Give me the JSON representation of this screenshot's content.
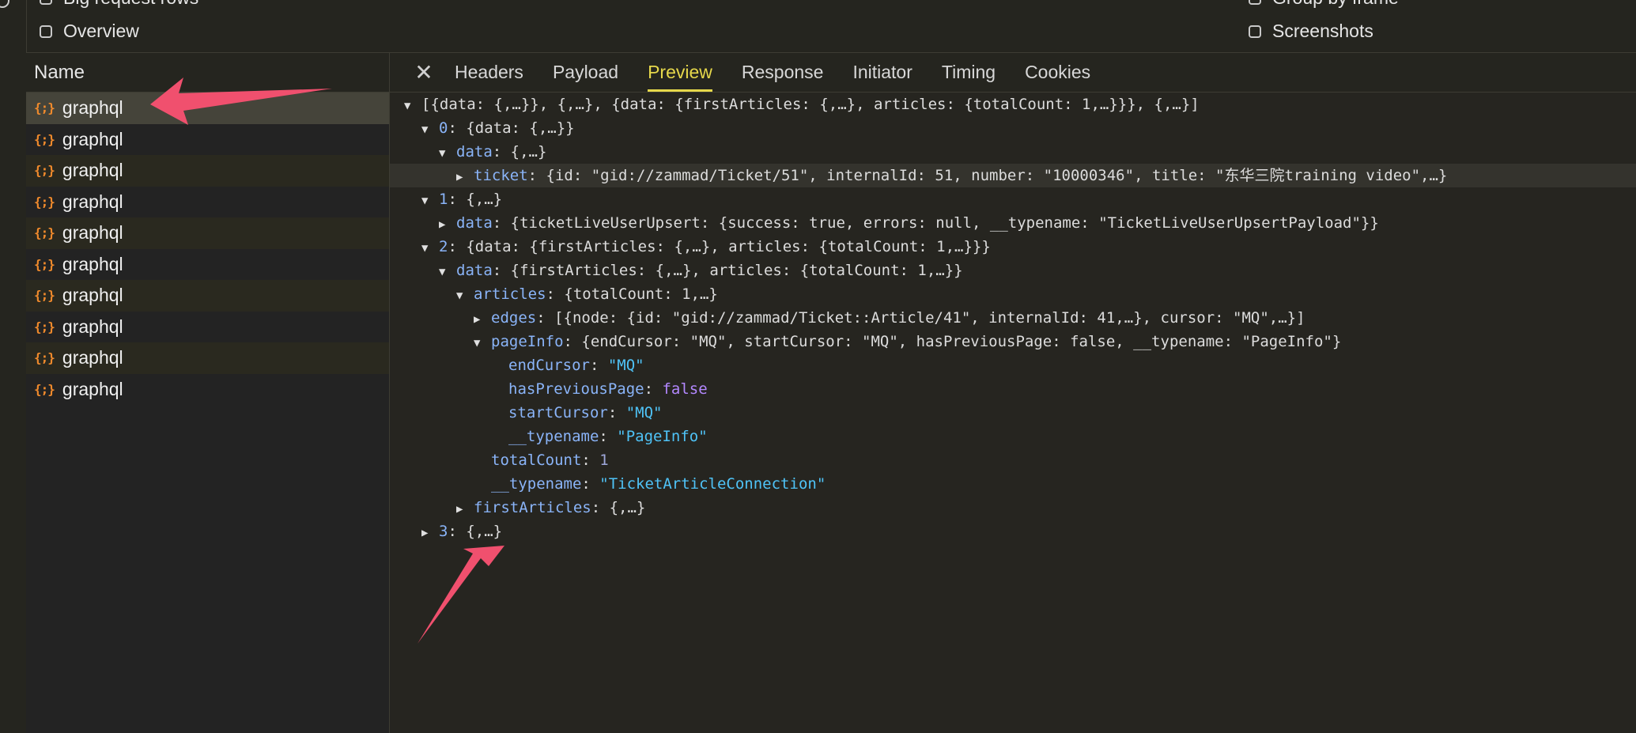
{
  "toolbar": {
    "options": [
      {
        "label": "Big request rows",
        "checked": false
      },
      {
        "label": "Overview",
        "checked": false
      },
      {
        "label": "Group by frame",
        "checked": false
      },
      {
        "label": "Screenshots",
        "checked": false
      }
    ]
  },
  "name_panel": {
    "header": "Name",
    "icon": "json-braces-icon",
    "icon_glyph": "{;}",
    "requests": [
      "graphql",
      "graphql",
      "graphql",
      "graphql",
      "graphql",
      "graphql",
      "graphql",
      "graphql",
      "graphql",
      "graphql"
    ]
  },
  "detail": {
    "tabs": [
      "Headers",
      "Payload",
      "Preview",
      "Response",
      "Initiator",
      "Timing",
      "Cookies"
    ],
    "active_tab": "Preview",
    "tree": [
      {
        "arrow": "▼",
        "text": "[{data: {,…}}, {,…}, {data: {firstArticles: {,…}, articles: {totalCount: 1,…}}}, {,…}]"
      },
      {
        "arrow": "▼",
        "key": "0",
        "text": "{data: {,…}}"
      },
      {
        "arrow": "▼",
        "key": "data",
        "text": "{,…}"
      },
      {
        "arrow": "▶",
        "key": "ticket",
        "text": "{id: \"gid://zammad/Ticket/51\", internalId: 51, number: \"10000346\", title: \"东华三院training video\",…}"
      },
      {
        "arrow": "▼",
        "key": "1",
        "text": "{,…}"
      },
      {
        "arrow": "▶",
        "key": "data",
        "text": "{ticketLiveUserUpsert: {success: true, errors: null, __typename: \"TicketLiveUserUpsertPayload\"}}"
      },
      {
        "arrow": "▼",
        "key": "2",
        "text": "{data: {firstArticles: {,…}, articles: {totalCount: 1,…}}}"
      },
      {
        "arrow": "▼",
        "key": "data",
        "text": "{firstArticles: {,…}, articles: {totalCount: 1,…}}"
      },
      {
        "arrow": "▼",
        "key": "articles",
        "text": "{totalCount: 1,…}"
      },
      {
        "arrow": "▶",
        "key": "edges",
        "text": "[{node: {id: \"gid://zammad/Ticket::Article/41\", internalId: 41,…}, cursor: \"MQ\",…}]"
      },
      {
        "arrow": "▼",
        "key": "pageInfo",
        "text": "{endCursor: \"MQ\", startCursor: \"MQ\", hasPreviousPage: false, __typename: \"PageInfo\"}"
      },
      {
        "arrow": "",
        "key": "endCursor",
        "value": "\"MQ\"",
        "vtype": "s"
      },
      {
        "arrow": "",
        "key": "hasPreviousPage",
        "value": "false",
        "vtype": "b"
      },
      {
        "arrow": "",
        "key": "startCursor",
        "value": "\"MQ\"",
        "vtype": "s"
      },
      {
        "arrow": "",
        "key": "__typename",
        "value": "\"PageInfo\"",
        "vtype": "s"
      },
      {
        "arrow": "",
        "key": "totalCount",
        "value": "1",
        "vtype": "n"
      },
      {
        "arrow": "",
        "key": "__typename",
        "value": "\"TicketArticleConnection\"",
        "vtype": "s"
      },
      {
        "arrow": "▶",
        "key": "firstArticles",
        "text": "{,…}"
      },
      {
        "arrow": "▶",
        "key": "3",
        "text": "{,…}"
      }
    ]
  },
  "colors": {
    "annotation_arrow": "#f0506e",
    "active_tab": "#e6d84b",
    "icon": "#f08a2c"
  }
}
